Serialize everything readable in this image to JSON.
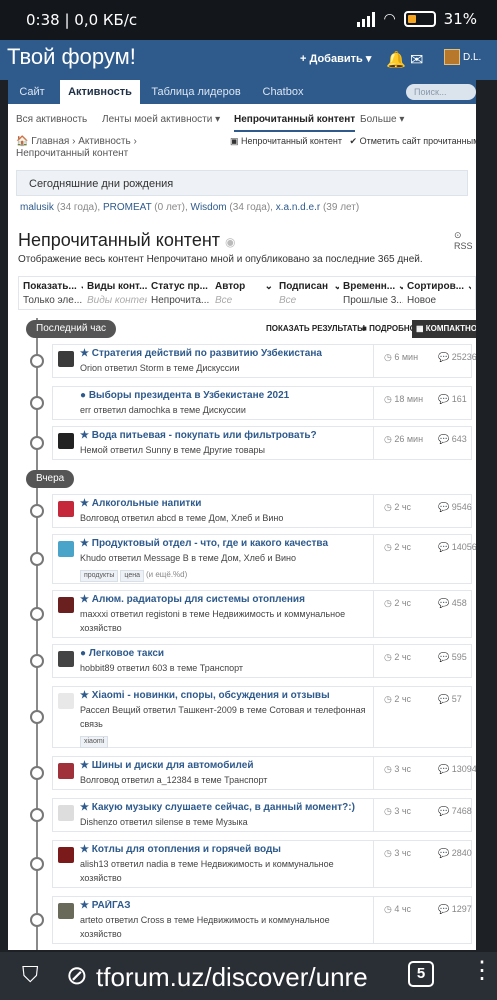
{
  "statusbar": {
    "time": "0:38 | 0,0 КБ/с",
    "battery": "31%"
  },
  "header": {
    "title": "Твой форум!",
    "add": "Добавить",
    "user": "D.L."
  },
  "nav": {
    "tabs": [
      "Сайт",
      "Активность",
      "Таблица лидеров",
      "Chatbox"
    ],
    "search_placeholder": "Поиск..."
  },
  "subnav": {
    "items": [
      "Вся активность",
      "Ленты моей активности",
      "Непрочитанный контент",
      "Больше"
    ]
  },
  "crumbs": {
    "home": "Главная",
    "activity": "Активность",
    "current": "Непрочитанный контент",
    "link1": "Непрочитанный контент",
    "link2": "Отметить сайт прочитанным"
  },
  "birthdays": {
    "title": "Сегодняшние дни рождения",
    "list": [
      {
        "name": "malusik",
        "age": "(34 года),"
      },
      {
        "name": "PROMEAT",
        "age": "(0 лет),"
      },
      {
        "name": "Wisdom",
        "age": "(34 года),"
      },
      {
        "name": "x.a.n.d.e.r",
        "age": "(39 лет)"
      }
    ]
  },
  "page": {
    "title": "Непрочитанный контент",
    "rss": "RSS",
    "desc": "Отображение весь контент Непрочитано мной и опубликовано за последние 365 дней."
  },
  "filters": [
    {
      "label": "Показать...",
      "value": "Только эле..."
    },
    {
      "label": "Виды конт...",
      "value": "Виды контент"
    },
    {
      "label": "Статус пр...",
      "value": "Непрочита..."
    },
    {
      "label": "Автор",
      "value": "Все"
    },
    {
      "label": "Подписан",
      "value": "Все"
    },
    {
      "label": "Временн...",
      "value": "Прошлые 3..."
    },
    {
      "label": "Сортиров...",
      "value": "Новое"
    }
  ],
  "groups": {
    "last_hour": "Последний час",
    "yesterday": "Вчера"
  },
  "view": {
    "show_results": "ПОКАЗАТЬ РЕЗУЛЬТАТЫ",
    "detailed": "ПОДРОБНО",
    "compact": "КОМПАКТНО"
  },
  "topics": [
    {
      "title": "Стратегия действий по развитию Узбекистана",
      "meta": "Orion ответил Storm в теме Дискуссии",
      "ago": "6 мин",
      "count": "25236",
      "icon": "star"
    },
    {
      "title": "Выборы президента в Узбекистане 2021",
      "meta": "err ответил damochka в теме Дискуссии",
      "ago": "18 мин",
      "count": "161",
      "icon": "dot"
    },
    {
      "title": "Вода питьевая - покупать или фильтровать?",
      "meta": "Немой ответил Sunny в теме Другие товары",
      "ago": "26 мин",
      "count": "643",
      "icon": "star"
    },
    {
      "title": "Алкогольные напитки",
      "meta": "Волговод ответил abcd в теме Дом, Хлеб и Вино",
      "ago": "2 чс",
      "count": "9546",
      "icon": "star"
    },
    {
      "title": "Продуктовый отдел - что, где и какого качества",
      "meta": "Khudo ответил Message B в теме Дом, Хлеб и Вино",
      "ago": "2 чс",
      "count": "14056",
      "icon": "star",
      "tags": [
        "продукты",
        "цена"
      ],
      "more": "(и ещё.%d)"
    },
    {
      "title": "Алюм. радиаторы для системы отопления",
      "meta": "maxxxi ответил registoni в теме Недвижимость и коммунальное хозяйство",
      "ago": "2 чс",
      "count": "458",
      "icon": "star"
    },
    {
      "title": "Легковое такси",
      "meta": "hobbit89 ответил 603 в теме Транспорт",
      "ago": "2 чс",
      "count": "595",
      "icon": "dot"
    },
    {
      "title": "Xiaomi - новинки, споры, обсуждения и отзывы",
      "meta": "Рассел Вещий ответил Ташкент-2009 в теме Сотовая и телефонная связь",
      "ago": "2 чс",
      "count": "57",
      "icon": "star",
      "tags": [
        "xiaomi"
      ]
    },
    {
      "title": "Шины и диски для автомобилей",
      "meta": "Волговод ответил a_12384 в теме Транспорт",
      "ago": "3 чс",
      "count": "13094",
      "icon": "star"
    },
    {
      "title": "Какую музыку слушаете сейчас, в данный момент?:)",
      "meta": "Dishenzo ответил silense в теме Музыка",
      "ago": "3 чс",
      "count": "7468",
      "icon": "star"
    },
    {
      "title": "Котлы для отопления и горячей воды",
      "meta": "alish13 ответил nadia в теме Недвижимость и коммунальное хозяйство",
      "ago": "3 чс",
      "count": "2840",
      "icon": "star"
    },
    {
      "title": "РАЙГАЗ",
      "meta": "arteto ответил Cross в теме Недвижимость и коммунальное хозяйство",
      "ago": "4 чс",
      "count": "1297",
      "icon": "star"
    }
  ],
  "urlbar": {
    "url": "tforum.uz/discover/unre",
    "tabs": "5"
  }
}
